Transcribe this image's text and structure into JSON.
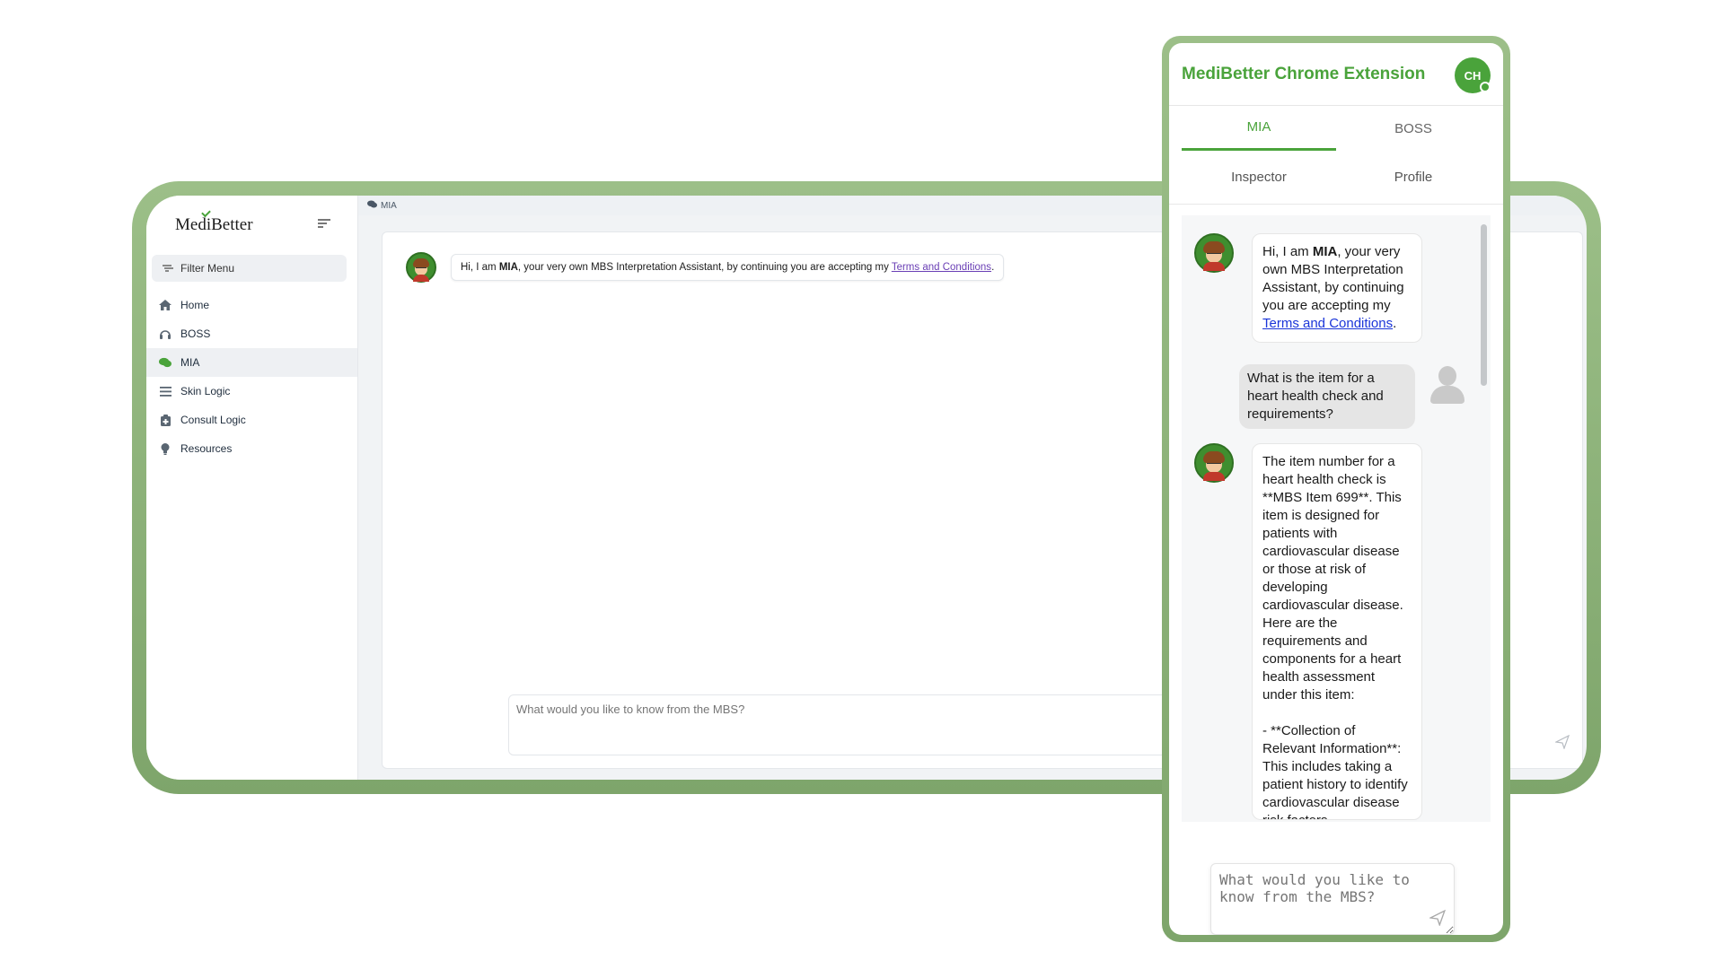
{
  "app": {
    "logo": "MediBetter",
    "filter_menu": "Filter Menu",
    "nav": [
      {
        "label": "Home",
        "icon": "home-icon"
      },
      {
        "label": "BOSS",
        "icon": "headset-icon"
      },
      {
        "label": "MIA",
        "icon": "chat-icon"
      },
      {
        "label": "Skin Logic",
        "icon": "list-icon"
      },
      {
        "label": "Consult Logic",
        "icon": "clipboard-icon"
      },
      {
        "label": "Resources",
        "icon": "lightbulb-icon"
      }
    ],
    "active_nav": "MIA",
    "breadcrumb": "MIA",
    "greeting": {
      "prefix": "Hi, I am ",
      "bold": "MIA",
      "suffix": ", your very own MBS Interpretation Assistant, by continuing you are accepting my ",
      "link": "Terms and Conditions",
      "end": "."
    },
    "input_placeholder": "What would you like to know from the MBS?"
  },
  "extension": {
    "title": "MediBetter Chrome Extension",
    "avatar_initials": "CH",
    "tabs": [
      "MIA",
      "BOSS"
    ],
    "active_tab": "MIA",
    "tabs2": [
      "Inspector",
      "Profile"
    ],
    "greeting": {
      "prefix": "Hi, I am ",
      "bold": "MIA",
      "suffix": ", your very own MBS Interpretation Assistant, by continuing you are accepting my ",
      "link": "Terms and Conditions",
      "end": "."
    },
    "user_message": "What is the item for a heart health check and requirements?",
    "reply": "The item number for a heart health check is **MBS Item 699**. This item is designed for patients with cardiovascular disease or those at risk of developing cardiovascular disease. Here are the requirements and components for a heart health assessment under this item:",
    "reply_bullet": "- **Collection of Relevant Information**: This includes taking a patient history to identify cardiovascular disease risk factors",
    "input_placeholder": "What would you like to know from the MBS?"
  },
  "colors": {
    "brand_green": "#4aa33b",
    "frame_green": "#8db27a",
    "link_blue": "#1a35d9",
    "link_purple": "#6a3fb5"
  }
}
